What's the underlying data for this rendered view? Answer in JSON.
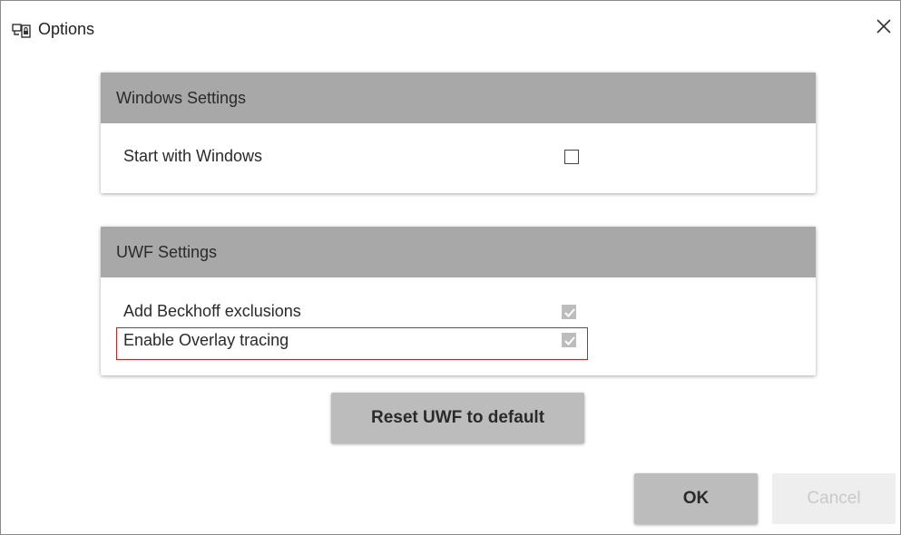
{
  "window": {
    "title": "Options",
    "app_icon": "options-app-icon",
    "close_icon": "close-icon",
    "close_glyph": "✕"
  },
  "windows_settings": {
    "header": "Windows Settings",
    "items": [
      {
        "label": "Start with Windows",
        "checked": false,
        "enabled": true
      }
    ]
  },
  "uwf_settings": {
    "header": "UWF Settings",
    "items": [
      {
        "label": "Add Beckhoff exclusions",
        "checked": true,
        "enabled": false
      },
      {
        "label": "Enable Overlay tracing",
        "checked": true,
        "enabled": false
      }
    ],
    "highlight_color": "#d21e1e"
  },
  "buttons": {
    "reset_label": "Reset UWF to default",
    "ok_label": "OK",
    "cancel_label": "Cancel"
  },
  "colors": {
    "header_bg": "#a8a8a8",
    "button_bg": "#bcbcbc",
    "disabled_button_bg": "#eeeeee"
  }
}
